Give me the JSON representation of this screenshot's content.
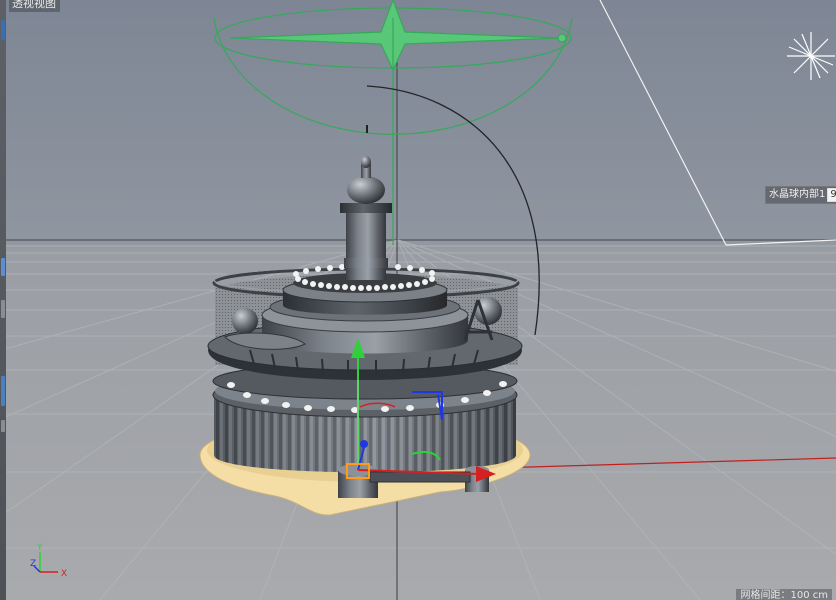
{
  "viewport": {
    "view_name": "透视视图",
    "selected_object_label": "水晶球内部1",
    "selected_object_tail": "9",
    "grid_spacing_label": "网格间距：100 cm"
  },
  "axis_gizmo": {
    "y_label": "Y",
    "z_label": "Z",
    "x_label": "X"
  },
  "colors": {
    "x_axis": "#d42020",
    "y_axis": "#2fd13a",
    "z_axis": "#2038e0",
    "sphere_gizmo": "#3aa95a",
    "background_top": "#7f8794",
    "background_bottom": "#a6a8ac"
  }
}
